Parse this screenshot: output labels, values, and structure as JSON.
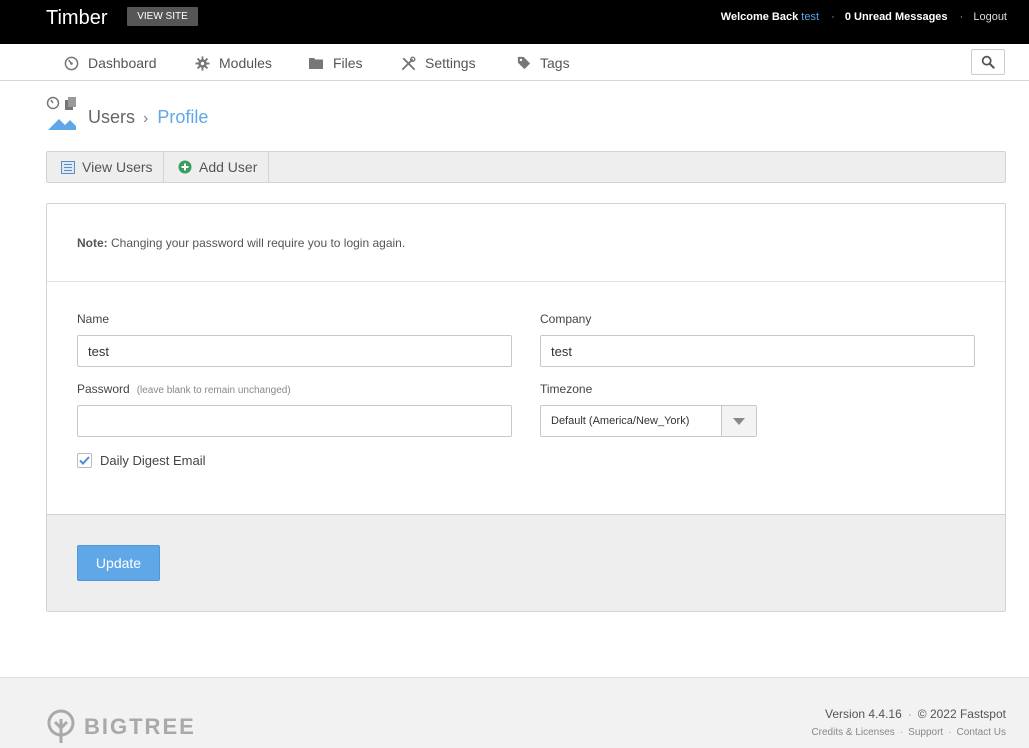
{
  "header": {
    "brand": "Timber",
    "view_site": "VIEW SITE",
    "welcome": "Welcome Back",
    "username": "test",
    "messages": "0 Unread Messages",
    "logout": "Logout"
  },
  "nav": {
    "items": [
      {
        "label": "Dashboard",
        "icon": "dashboard-icon"
      },
      {
        "label": "Modules",
        "icon": "gear-icon"
      },
      {
        "label": "Files",
        "icon": "folder-icon"
      },
      {
        "label": "Settings",
        "icon": "tools-icon"
      },
      {
        "label": "Tags",
        "icon": "tag-icon"
      }
    ],
    "search_icon": "search-icon"
  },
  "breadcrumb": {
    "parent": "Users",
    "separator": "›",
    "current": "Profile"
  },
  "subnav": {
    "view_users": "View Users",
    "add_user": "Add User"
  },
  "form": {
    "note_bold": "Note:",
    "note_text": " Changing your password will require you to login again.",
    "name_label": "Name",
    "name_value": "test",
    "company_label": "Company",
    "company_value": "test",
    "password_label": "Password",
    "password_hint": "(leave blank to remain unchanged)",
    "password_value": "",
    "timezone_label": "Timezone",
    "timezone_value": "Default (America/New_York)",
    "digest_label": "Daily Digest Email",
    "digest_checked": true,
    "update_label": "Update"
  },
  "footer": {
    "logo_text": "BIGTREE",
    "version": "Version 4.4.16",
    "copyright": "© 2022 Fastspot",
    "credits": "Credits & Licenses",
    "support": "Support",
    "contact": "Contact Us"
  },
  "colors": {
    "accent": "#5fa7e6",
    "topbar": "#000000",
    "panel": "#eeeeee"
  }
}
